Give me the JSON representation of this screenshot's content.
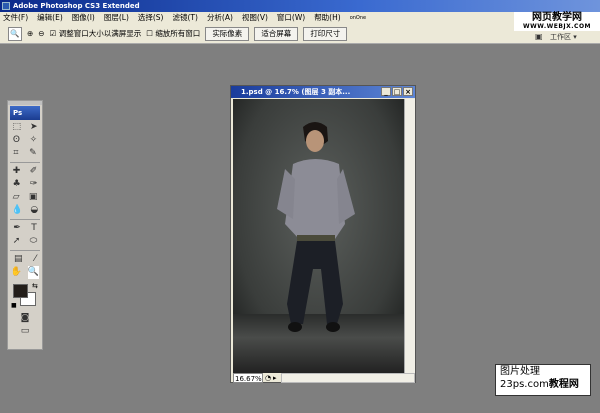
{
  "app": {
    "title": "Adobe Photoshop CS3 Extended",
    "logo": "Ps"
  },
  "menu": [
    "文件(F)",
    "编辑(E)",
    "图像(I)",
    "图层(L)",
    "选择(S)",
    "滤镜(T)",
    "分析(A)",
    "视图(V)",
    "窗口(W)",
    "帮助(H)",
    "onOne"
  ],
  "options": {
    "resize_checkbox": "调整窗口大小以满屏显示",
    "zoom_all_checkbox": "缩放所有窗口",
    "actual_pixels": "实际像素",
    "fit_screen": "适合屏幕",
    "print_size": "打印尺寸",
    "workspace": "工作区 ▾"
  },
  "watermark_top": {
    "line1": "网页教学网",
    "line2": "WWW.WEBJX.COM"
  },
  "watermark_bottom": {
    "line1": "图片处理",
    "line2": "23ps.com",
    "line3": "教程网"
  },
  "document": {
    "title": "1.psd @ 16.7% (图层 3 副本...",
    "zoom": "16.67%"
  }
}
